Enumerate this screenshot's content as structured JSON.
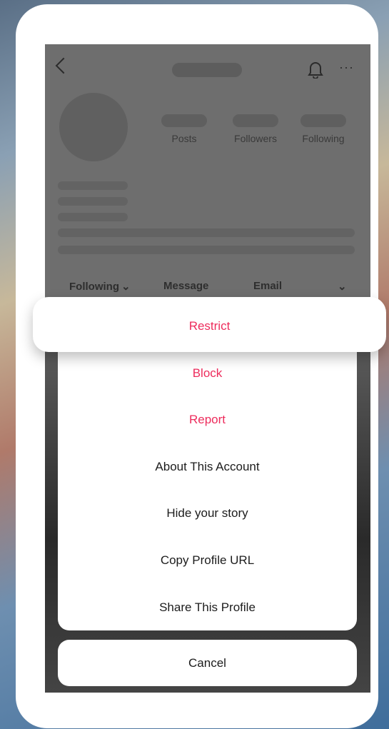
{
  "profile": {
    "stats": {
      "posts_label": "Posts",
      "followers_label": "Followers",
      "following_label": "Following"
    },
    "actions": {
      "following_label": "Following",
      "following_chevron": "⌄",
      "message_label": "Message",
      "email_label": "Email"
    },
    "more_icon": "···"
  },
  "sheet": {
    "items": [
      {
        "label": "Restrict",
        "style": "destructive"
      },
      {
        "label": "Block",
        "style": "destructive"
      },
      {
        "label": "Report",
        "style": "destructive"
      },
      {
        "label": "About This Account",
        "style": "default"
      },
      {
        "label": "Hide your story",
        "style": "default"
      },
      {
        "label": "Copy Profile URL",
        "style": "default"
      },
      {
        "label": "Share This Profile",
        "style": "default"
      }
    ],
    "cancel_label": "Cancel",
    "destructive_color": "#ed2c5c"
  },
  "icons": [
    "chevron-left-icon",
    "bell-icon",
    "more-icon",
    "chevron-down-icon"
  ]
}
